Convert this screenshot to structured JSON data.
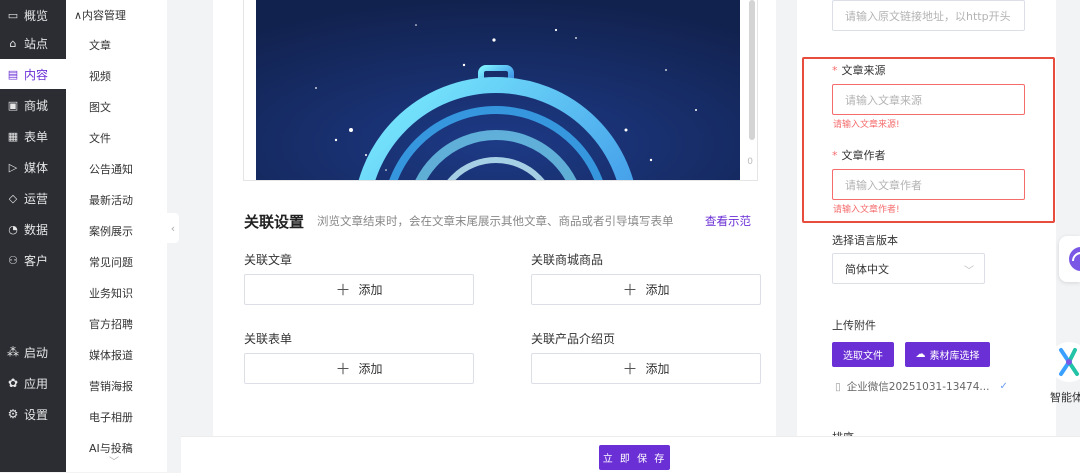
{
  "colors": {
    "accent": "#6b2fd6",
    "error": "#f56c6c",
    "sidebar_bg": "#2b2d33"
  },
  "sidebar": {
    "items": [
      {
        "label": "概览",
        "icon": "monitor-icon",
        "glyph": "▭",
        "active": false
      },
      {
        "label": "站点",
        "icon": "home-icon",
        "glyph": "⌂",
        "active": false
      },
      {
        "label": "内容",
        "icon": "document-icon",
        "glyph": "▤",
        "active": true
      },
      {
        "label": "商城",
        "icon": "shop-icon",
        "glyph": "▣",
        "active": false
      },
      {
        "label": "表单",
        "icon": "form-icon",
        "glyph": "▦",
        "active": false
      },
      {
        "label": "媒体",
        "icon": "video-icon",
        "glyph": "▷",
        "active": false
      },
      {
        "label": "运营",
        "icon": "tag-icon",
        "glyph": "◇",
        "active": false
      },
      {
        "label": "数据",
        "icon": "chart-pie-icon",
        "glyph": "◔",
        "active": false
      },
      {
        "label": "客户",
        "icon": "user-icon",
        "glyph": "⚇",
        "active": false
      }
    ],
    "bottom_items": [
      {
        "label": "启动",
        "icon": "launch-icon",
        "glyph": "⁂"
      },
      {
        "label": "应用",
        "icon": "apps-icon",
        "glyph": "✿"
      },
      {
        "label": "设置",
        "icon": "gear-icon",
        "glyph": "⚙"
      }
    ]
  },
  "submenu": {
    "group": "∧内容管理",
    "items": [
      "文章",
      "视频",
      "图文",
      "文件",
      "公告通知",
      "最新活动",
      "案例展示",
      "常见问题",
      "业务知识",
      "官方招聘",
      "媒体报道",
      "营销海报",
      "电子相册",
      "AI与投稿"
    ],
    "more_glyph": "﹀"
  },
  "collapse_glyph": "‹",
  "preview": {
    "counter": "0"
  },
  "related": {
    "title": "关联设置",
    "desc": "浏览文章结束时，会在文章末尾展示其他文章、商品或者引导填写表单",
    "link": "查看示范",
    "add_label": "添加",
    "plus": "＋",
    "fields": [
      "关联文章",
      "关联商城商品",
      "关联表单",
      "关联产品介绍页"
    ]
  },
  "form": {
    "link_placeholder": "请输入原文链接地址，以http开头",
    "source": {
      "label": "文章来源",
      "placeholder": "请输入文章来源",
      "error": "请输入文章来源!"
    },
    "author": {
      "label": "文章作者",
      "placeholder": "请输入文章作者",
      "error": "请输入文章作者!"
    },
    "lang": {
      "label": "选择语言版本",
      "value": "简体中文"
    },
    "attachment": {
      "label": "上传附件",
      "choose_btn": "选取文件",
      "library_btn": "素材库选择",
      "file_name": "企业微信20251031-13474...",
      "file_glyph": "▯",
      "ok_glyph": "✓"
    },
    "sort_label": "排序"
  },
  "bottom_bar": {
    "save": "立 即 保 存"
  },
  "float": {
    "ai_label": "智能体"
  }
}
